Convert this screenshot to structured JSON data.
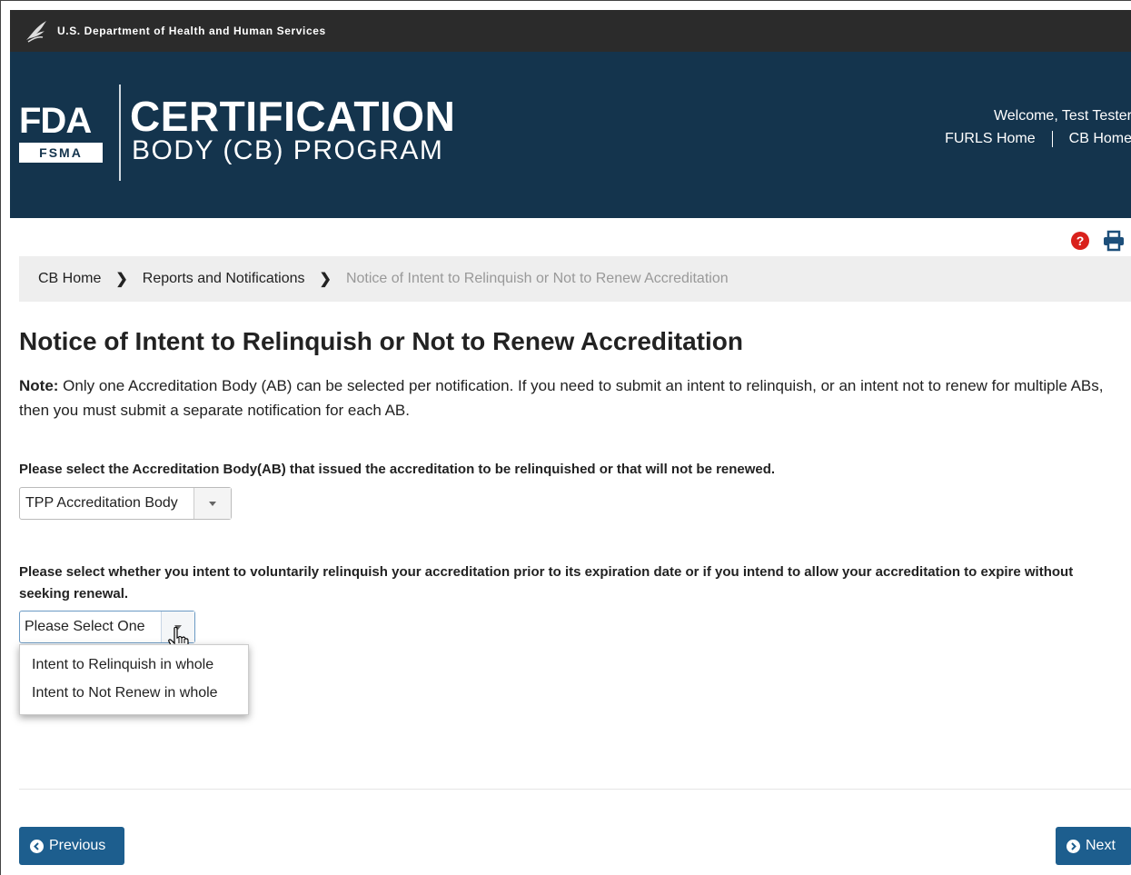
{
  "hhs_bar": {
    "text": "U.S. Department of Health and Human Services",
    "icon": "hhs-eagle-icon"
  },
  "banner": {
    "logo_word": "FDA",
    "logo_sub": "FSMA",
    "title_line1": "CERTIFICATION",
    "title_line2": "BODY (CB) PROGRAM",
    "welcome": "Welcome, Test Tester",
    "links": [
      "FURLS Home",
      "CB Home"
    ],
    "bg_color": "#14344d"
  },
  "utility_icons": {
    "help": "?",
    "help_icon": "question-circle-icon",
    "print_icon": "print-icon"
  },
  "breadcrumb": {
    "items": [
      "CB Home",
      "Reports and Notifications"
    ],
    "current": "Notice of Intent to Relinquish or Not to Renew Accreditation"
  },
  "page": {
    "title": "Notice of Intent to Relinquish or Not to Renew Accreditation",
    "note_label": "Note:",
    "note_text": " Only one Accreditation Body (AB) can be selected per notification. If you need to submit an intent to relinquish, or an intent not to renew for multiple ABs, then you must submit a separate notification for each AB."
  },
  "form": {
    "q1_label": "Please select the Accreditation Body(AB) that issued the accreditation to be relinquished or that will not be renewed.",
    "q1_value": "TPP Accreditation Body",
    "q2_label": "Please select whether you intent to voluntarily relinquish your accreditation prior to its expiration date or if you intend to allow your accreditation to expire without seeking renewal.",
    "q2_value": "Please Select One",
    "q2_options": [
      "Intent to Relinquish in whole",
      "Intent to Not Renew in whole"
    ]
  },
  "nav": {
    "previous": "Previous",
    "next": "Next",
    "button_color": "#1d5e8e"
  }
}
